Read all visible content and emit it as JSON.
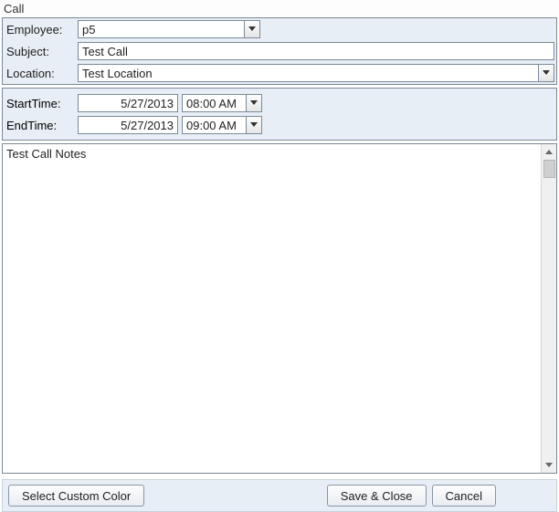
{
  "window": {
    "title": "Call"
  },
  "form": {
    "employee": {
      "label": "Employee:",
      "value": "p5"
    },
    "subject": {
      "label": "Subject:",
      "value": "Test Call"
    },
    "location": {
      "label": "Location:",
      "value": "Test Location"
    },
    "start": {
      "label": "StartTime:",
      "date": "5/27/2013",
      "time": "08:00 AM"
    },
    "end": {
      "label": "EndTime:",
      "date": "5/27/2013",
      "time": "09:00 AM"
    },
    "notes": "Test Call Notes"
  },
  "buttons": {
    "select_color": "Select Custom Color",
    "save_close": "Save & Close",
    "cancel": "Cancel"
  }
}
